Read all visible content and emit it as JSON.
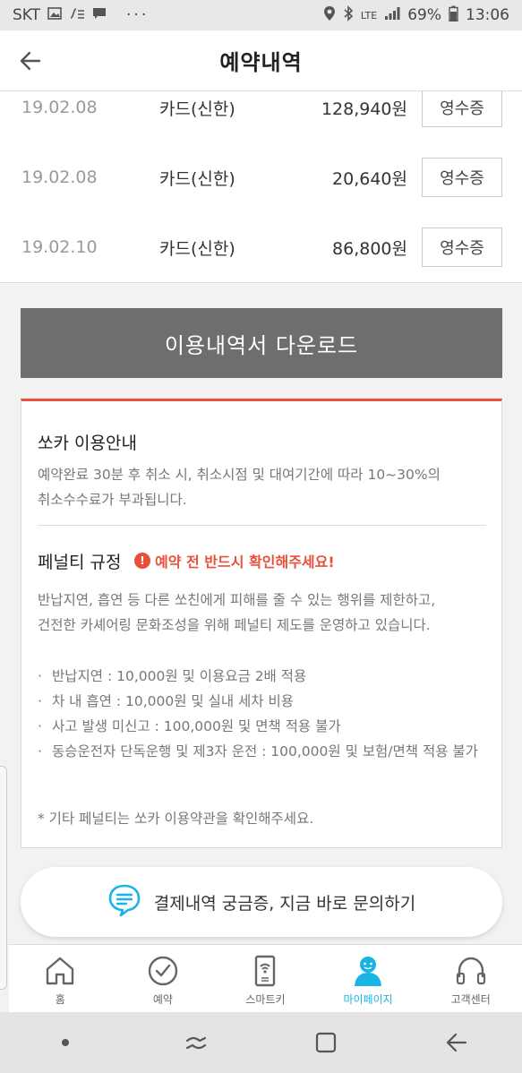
{
  "status_bar": {
    "carrier": "SKT",
    "network": "LTE",
    "battery": "69%",
    "time": "13:06",
    "more": "···"
  },
  "header": {
    "title": "예약내역"
  },
  "payments": [
    {
      "date": "19.02.08",
      "method": "카드(신한)",
      "amount": "128,940원",
      "receipt_label": "영수증"
    },
    {
      "date": "19.02.08",
      "method": "카드(신한)",
      "amount": "20,640원",
      "receipt_label": "영수증"
    },
    {
      "date": "19.02.10",
      "method": "카드(신한)",
      "amount": "86,800원",
      "receipt_label": "영수증"
    }
  ],
  "download_button": "이용내역서 다운로드",
  "guide": {
    "title": "쏘카 이용안내",
    "text_line1": "예약완료 30분 후 취소 시, 취소시점 및 대여기간에 따라 10~30%의",
    "text_line2": "취소수수료가 부과됩니다."
  },
  "penalty": {
    "title": "페널티 규정",
    "warning": "예약 전 반드시 확인해주세요!",
    "text_line1": "반납지연, 흡연 등 다른 쏘친에게 피해를 줄 수 있는 행위를 제한하고,",
    "text_line2": "건전한 카셰어링 문화조성을 위해 페널티 제도를 운영하고 있습니다.",
    "items": [
      "반납지연 : 10,000원 및 이용요금 2배 적용",
      "차 내 흡연 : 10,000원 및 실내 세차 비용",
      "사고 발생 미신고 : 100,000원 및 면책 적용 불가",
      "동승운전자 단독운행 및 제3자 운전 : 100,000원 및 보험/면책 적용 불가"
    ],
    "note": "*  기타 페널티는 쏘카 이용약관을 확인해주세요."
  },
  "inquiry_button": "결제내역 궁금증, 지금 바로 문의하기",
  "tabs": [
    {
      "label": "홈",
      "icon": "home-icon"
    },
    {
      "label": "예약",
      "icon": "clock-check-icon"
    },
    {
      "label": "스마트키",
      "icon": "smartkey-icon"
    },
    {
      "label": "마이페이지",
      "icon": "mypage-icon",
      "active": true
    },
    {
      "label": "고객센터",
      "icon": "headset-icon"
    }
  ],
  "colors": {
    "accent_red": "#e8503a",
    "active_blue": "#19b4e6",
    "download_gray": "#6e6e6e"
  }
}
